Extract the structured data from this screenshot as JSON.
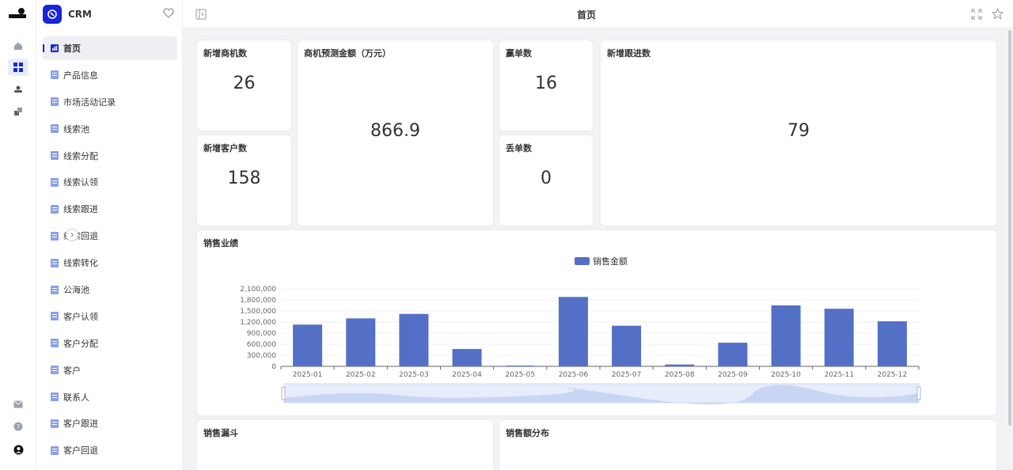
{
  "brand": {
    "name": "CRM"
  },
  "header": {
    "title": "首页"
  },
  "menu": {
    "items": [
      {
        "label": "首页"
      },
      {
        "label": "产品信息"
      },
      {
        "label": "市场活动记录"
      },
      {
        "label": "线索池"
      },
      {
        "label": "线索分配"
      },
      {
        "label": "线索认领"
      },
      {
        "label": "线索跟进"
      },
      {
        "label": "线索回退"
      },
      {
        "label": "线索转化"
      },
      {
        "label": "公海池"
      },
      {
        "label": "客户认领"
      },
      {
        "label": "客户分配"
      },
      {
        "label": "客户"
      },
      {
        "label": "联系人"
      },
      {
        "label": "客户跟进"
      },
      {
        "label": "客户回退"
      }
    ]
  },
  "stats": {
    "new_opportunities": {
      "title": "新增商机数",
      "value": "26"
    },
    "forecast_amount": {
      "title": "商机预测金额（万元）",
      "value": "866.9"
    },
    "won": {
      "title": "赢单数",
      "value": "16"
    },
    "new_followups": {
      "title": "新增跟进数",
      "value": "79"
    },
    "new_customers": {
      "title": "新增客户数",
      "value": "158"
    },
    "lost": {
      "title": "丢单数",
      "value": "0"
    }
  },
  "sales_chart": {
    "title": "销售业绩"
  },
  "bottom": {
    "funnel_title": "销售漏斗",
    "distribution_title": "销售额分布"
  },
  "colors": {
    "accent": "#1726d8",
    "bar": "#5470c6"
  },
  "chart_data": {
    "type": "bar",
    "title": "销售业绩",
    "categories": [
      "2025-01",
      "2025-02",
      "2025-03",
      "2025-04",
      "2025-05",
      "2025-06",
      "2025-07",
      "2025-08",
      "2025-09",
      "2025-10",
      "2025-11",
      "2025-12"
    ],
    "series": [
      {
        "name": "销售金额",
        "values": [
          1130000,
          1300000,
          1420000,
          470000,
          20000,
          1880000,
          1100000,
          50000,
          640000,
          1650000,
          1560000,
          1220000
        ]
      }
    ],
    "yticks": [
      "0",
      "300,000",
      "600,000",
      "900,000",
      "1,200,000",
      "1,500,000",
      "1,800,000",
      "2,100,000"
    ],
    "ylim": [
      0,
      2100000
    ],
    "legend": "top-center",
    "grid": true
  }
}
